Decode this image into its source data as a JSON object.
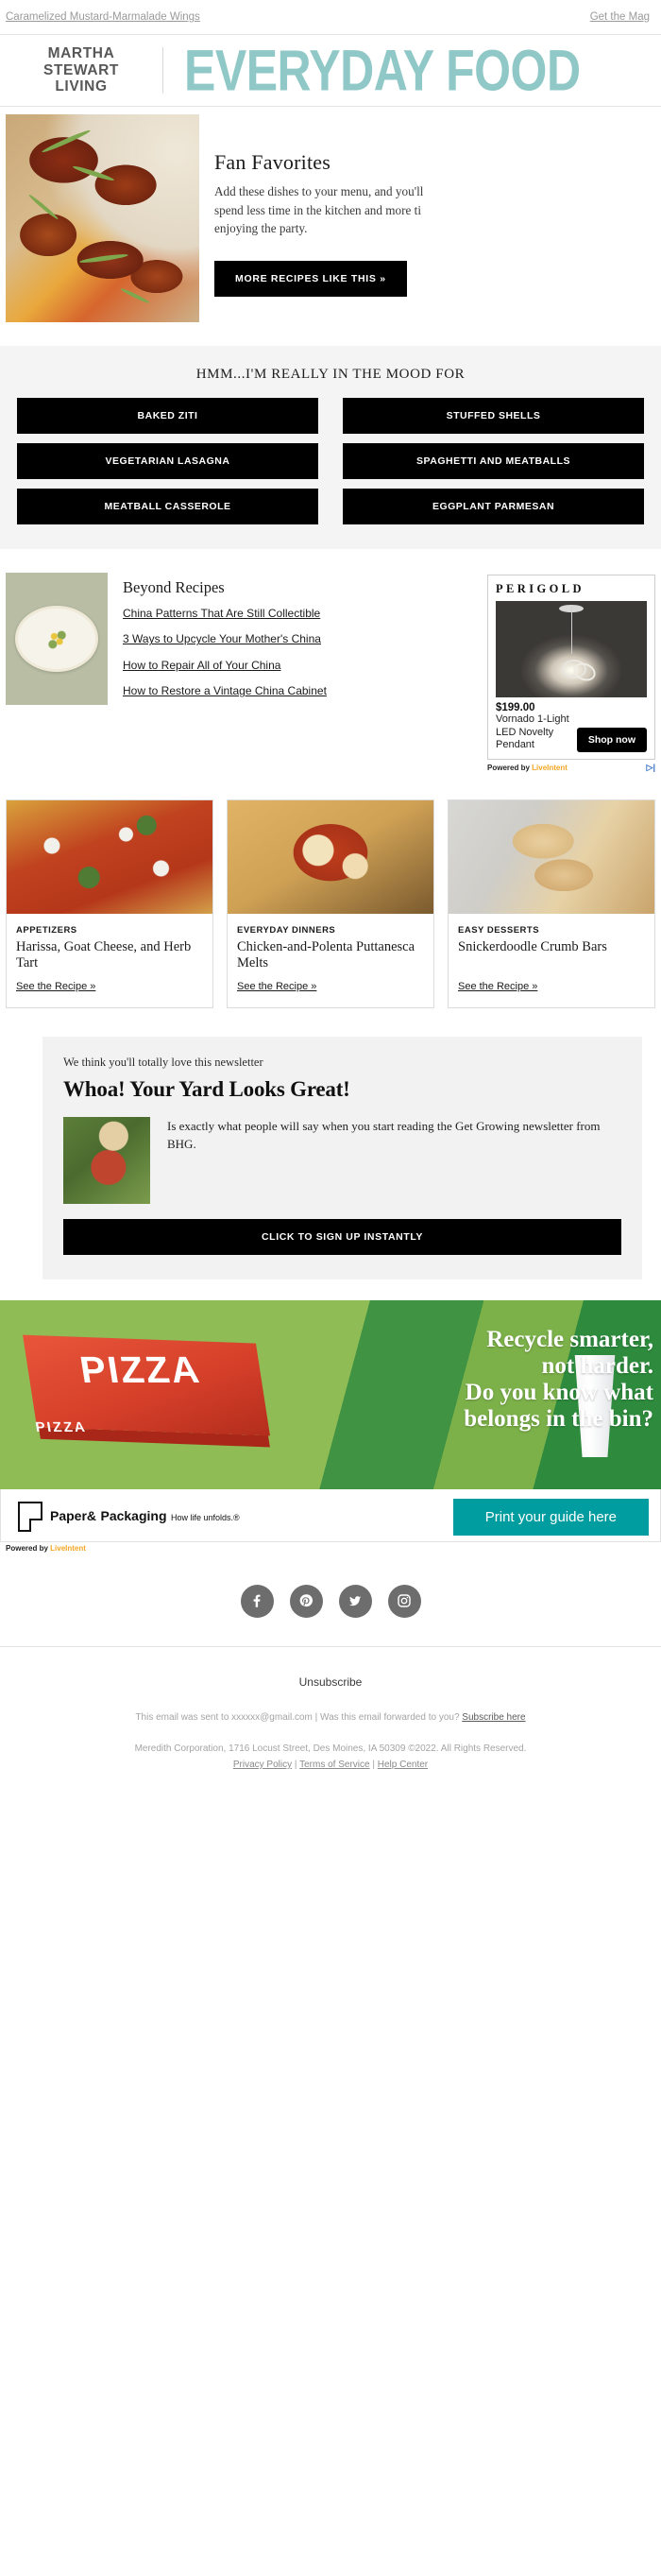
{
  "preheader": {
    "subject_link": "Caramelized Mustard-Marmalade Wings",
    "magazine_link": "Get the Mag"
  },
  "masthead": {
    "brand_line1": "MARTHA",
    "brand_line2": "STEWART",
    "brand_line3": "LIVING",
    "logo": "EVERYDAY FOOD",
    "logo_color": "#8fc8c6"
  },
  "hero": {
    "title": "Fan Favorites",
    "body": "Add these dishes to your menu, and you'll spend less time in the kitchen and more time enjoying the party.",
    "body_line1": "Add these dishes to your menu, and you'll",
    "body_line2": "spend less time in the kitchen and more ti",
    "body_line3": "enjoying the party.",
    "cta": "MORE RECIPES LIKE THIS »",
    "image_alt": "caramelized chicken wings with scallions"
  },
  "mood": {
    "title": "HMM...I'M REALLY IN THE MOOD FOR",
    "buttons": [
      "BAKED ZITI",
      "STUFFED SHELLS",
      "VEGETARIAN LASAGNA",
      "SPAGHETTI AND MEATBALLS",
      "MEATBALL CASSEROLE",
      "EGGPLANT PARMESAN"
    ]
  },
  "beyond": {
    "title": "Beyond Recipes",
    "image_alt": "vintage floral china platter",
    "links": [
      "China Patterns That Are Still Collectible",
      "3 Ways to Upcycle Your Mother's China",
      "How to Repair All of Your China",
      "How to Restore a Vintage China Cabinet"
    ]
  },
  "ad": {
    "brand": "PERIGOLD",
    "price": "$199.00",
    "product": "Vornado 1-Light LED Novelty Pendant",
    "cta": "Shop now",
    "powered_by": "Powered by",
    "network": "LiveIntent",
    "adchoices": "AdChoices",
    "image_alt": "LED pendant light"
  },
  "cards": [
    {
      "kicker": "APPETIZERS",
      "title": "Harissa, Goat Cheese, and Herb Tart",
      "link": "See the Recipe »",
      "image_alt": "harissa goat cheese herb tart"
    },
    {
      "kicker": "EVERYDAY DINNERS",
      "title": "Chicken-and-Polenta Puttanesca Melts",
      "link": "See the Recipe »",
      "image_alt": "chicken and polenta puttanesca melts in skillet"
    },
    {
      "kicker": "EASY DESSERTS",
      "title": "Snickerdoodle Crumb Bars",
      "link": "See the Recipe »",
      "image_alt": "snickerdoodle crumb bars"
    }
  ],
  "promo": {
    "eyebrow": "We think you'll totally love this newsletter",
    "title": "Whoa! Your Yard Looks Great!",
    "copy": "Is exactly what people will say when you start reading the Get Growing newsletter from BHG.",
    "cta": "CLICK TO SIGN UP INSTANTLY",
    "image_alt": "gardener in straw hat watering plants"
  },
  "banner": {
    "headline_line1": "Recycle smarter,",
    "headline_line2": "not harder.",
    "headline_line3": "Do you know what",
    "headline_line4": "belongs in the bin?",
    "pizza_word": "PIZZA",
    "pizza_word_small": "PIZZA",
    "logo_line1": "Paper&",
    "logo_line2": "Packaging",
    "logo_tagline": "How life unfolds.®",
    "cta": "Print your guide here",
    "cta_color": "#009da0",
    "powered_by": "Powered by",
    "network": "LiveIntent"
  },
  "social": [
    {
      "name": "facebook",
      "label": "Facebook"
    },
    {
      "name": "pinterest",
      "label": "Pinterest"
    },
    {
      "name": "twitter",
      "label": "Twitter"
    },
    {
      "name": "instagram",
      "label": "Instagram"
    }
  ],
  "footer": {
    "unsubscribe": "Unsubscribe",
    "sent_to": "This email was sent to xxxxxx@gmail.com  |  Was this email forwarded to you?",
    "subscribe_link": "Subscribe here",
    "company": "Meredith Corporation, 1716 Locust Street, Des Moines, IA 50309 ©2022. All Rights Reserved.",
    "privacy": "Privacy Policy",
    "terms": "Terms of Service",
    "help": "Help Center",
    "sep": "|"
  }
}
